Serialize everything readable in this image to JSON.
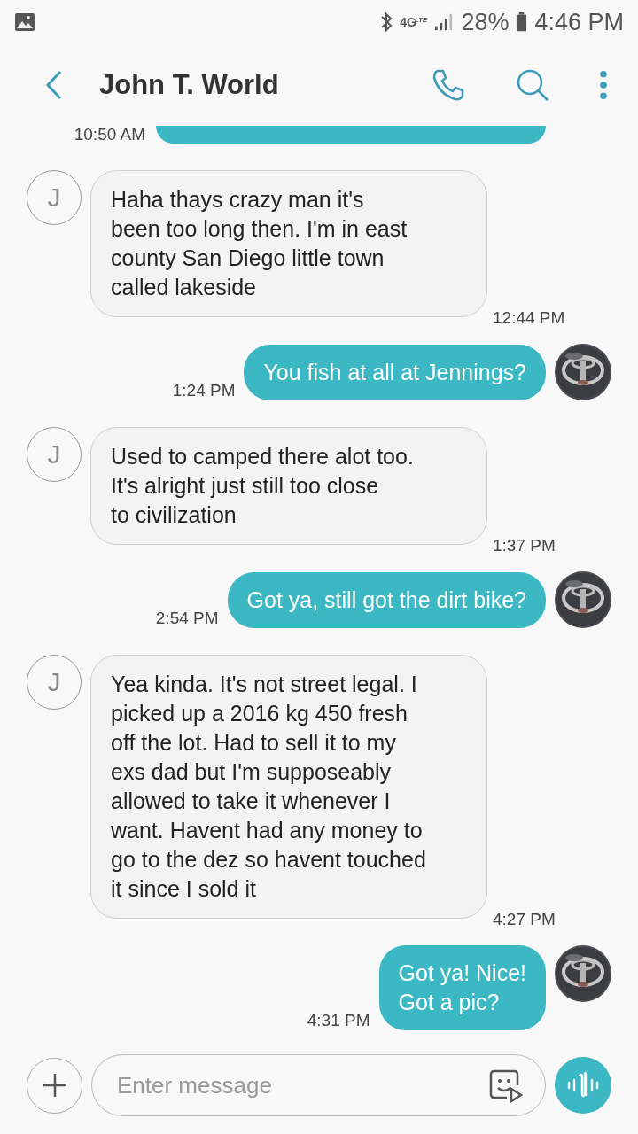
{
  "status_bar": {
    "battery": "28%",
    "time": "4:46 PM",
    "network": "4G",
    "network_sub": "LTE"
  },
  "header": {
    "title": "John T. World"
  },
  "messages": [
    {
      "kind": "sent",
      "time": "10:50 AM",
      "cut": true
    },
    {
      "kind": "received",
      "avatar": "J",
      "text": "Haha thays crazy man it's\nbeen too long then. I'm in east\ncounty San Diego little town\ncalled lakeside",
      "time": "12:44 PM"
    },
    {
      "kind": "sent",
      "text": "You fish at all at Jennings?",
      "time": "1:24 PM"
    },
    {
      "kind": "received",
      "avatar": "J",
      "text": "Used to camped there alot too.\nIt's alright just still too close\nto civilization",
      "time": "1:37 PM"
    },
    {
      "kind": "sent",
      "text": "Got ya, still got the dirt bike?",
      "time": "2:54 PM"
    },
    {
      "kind": "received",
      "avatar": "J",
      "text": "Yea kinda. It's not street legal. I\npicked up a 2016 kg 450 fresh\noff the lot. Had to sell it to my\nexs dad but I'm supposeably\nallowed to take it whenever I\nwant. Havent had any money to\ngo to the dez so havent touched\nit since I sold it",
      "time": "4:27 PM"
    },
    {
      "kind": "sent",
      "text": "Got ya! Nice!\nGot a pic?",
      "time": "4:31 PM"
    }
  ],
  "composer": {
    "placeholder": "Enter message"
  }
}
